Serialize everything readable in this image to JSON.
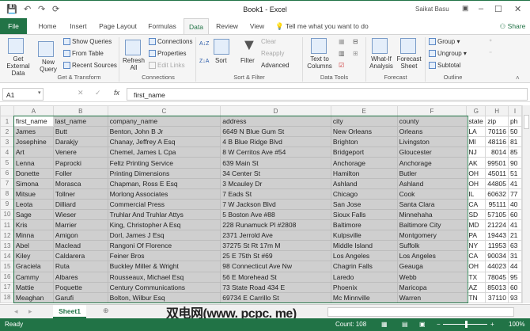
{
  "title": "Book1  -  Excel",
  "user": "Saikat Basu",
  "tabs": [
    "File",
    "Home",
    "Insert",
    "Page Layout",
    "Formulas",
    "Data",
    "Review",
    "View"
  ],
  "tell_me": "Tell me what you want to do",
  "share": "Share",
  "ribbon": {
    "get_external": "Get External Data",
    "new_query": "New Query",
    "show_queries": "Show Queries",
    "from_table": "From Table",
    "recent_sources": "Recent Sources",
    "get_transform": "Get & Transform",
    "refresh_all": "Refresh All",
    "connections": "Connections",
    "properties": "Properties",
    "edit_links": "Edit Links",
    "connections_group": "Connections",
    "sort": "Sort",
    "filter": "Filter",
    "clear": "Clear",
    "reapply": "Reapply",
    "advanced": "Advanced",
    "sort_filter": "Sort & Filter",
    "text_to_columns": "Text to Columns",
    "data_tools": "Data Tools",
    "what_if": "What-If Analysis",
    "forecast_sheet": "Forecast Sheet",
    "forecast": "Forecast",
    "group": "Group",
    "ungroup": "Ungroup",
    "subtotal": "Subtotal",
    "outline": "Outline"
  },
  "name_box": "A1",
  "formula": "first_name",
  "columns": [
    "A",
    "B",
    "C",
    "D",
    "E",
    "F",
    "G",
    "H",
    "I"
  ],
  "rows": [
    [
      "first_name",
      "last_name",
      "company_name",
      "address",
      "city",
      "county",
      "state",
      "zip",
      "ph"
    ],
    [
      "James",
      "Butt",
      "Benton, John B Jr",
      "6649 N Blue Gum St",
      "New Orleans",
      "Orleans",
      "LA",
      "70116",
      "50"
    ],
    [
      "Josephine",
      "Darakjy",
      "Chanay, Jeffrey A Esq",
      "4 B Blue Ridge Blvd",
      "Brighton",
      "Livingston",
      "MI",
      "48116",
      "81"
    ],
    [
      "Art",
      "Venere",
      "Chemel, James L Cpa",
      "8 W Cerritos Ave #54",
      "Bridgeport",
      "Gloucester",
      "NJ",
      "8014",
      "85"
    ],
    [
      "Lenna",
      "Paprocki",
      "Feltz Printing Service",
      "639 Main St",
      "Anchorage",
      "Anchorage",
      "AK",
      "99501",
      "90"
    ],
    [
      "Donette",
      "Foller",
      "Printing Dimensions",
      "34 Center St",
      "Hamilton",
      "Butler",
      "OH",
      "45011",
      "51"
    ],
    [
      "Simona",
      "Morasca",
      "Chapman, Ross E Esq",
      "3 Mcauley Dr",
      "Ashland",
      "Ashland",
      "OH",
      "44805",
      "41"
    ],
    [
      "Mitsue",
      "Tollner",
      "Morlong Associates",
      "7 Eads St",
      "Chicago",
      "Cook",
      "IL",
      "60632",
      "77"
    ],
    [
      "Leota",
      "Dilliard",
      "Commercial Press",
      "7 W Jackson Blvd",
      "San Jose",
      "Santa Clara",
      "CA",
      "95111",
      "40"
    ],
    [
      "Sage",
      "Wieser",
      "Truhlar And Truhlar Attys",
      "5 Boston Ave #88",
      "Sioux Falls",
      "Minnehaha",
      "SD",
      "57105",
      "60"
    ],
    [
      "Kris",
      "Marrier",
      "King, Christopher A Esq",
      "228 Runamuck Pl #2808",
      "Baltimore",
      "Baltimore City",
      "MD",
      "21224",
      "41"
    ],
    [
      "Minna",
      "Amigon",
      "Dorl, James J Esq",
      "2371 Jerrold Ave",
      "Kulpsville",
      "Montgomery",
      "PA",
      "19443",
      "21"
    ],
    [
      "Abel",
      "Maclead",
      "Rangoni Of Florence",
      "37275 St  Rt 17m M",
      "Middle Island",
      "Suffolk",
      "NY",
      "11953",
      "63"
    ],
    [
      "Kiley",
      "Caldarera",
      "Feiner Bros",
      "25 E 75th St #69",
      "Los Angeles",
      "Los Angeles",
      "CA",
      "90034",
      "31"
    ],
    [
      "Graciela",
      "Ruta",
      "Buckley Miller & Wright",
      "98 Connecticut Ave Nw",
      "Chagrin Falls",
      "Geauga",
      "OH",
      "44023",
      "44"
    ],
    [
      "Cammy",
      "Albares",
      "Rousseaux, Michael Esq",
      "56 E Morehead St",
      "Laredo",
      "Webb",
      "TX",
      "78045",
      "95"
    ],
    [
      "Mattie",
      "Poquette",
      "Century Communications",
      "73 State Road 434 E",
      "Phoenix",
      "Maricopa",
      "AZ",
      "85013",
      "60"
    ],
    [
      "Meaghan",
      "Garufi",
      "Bolton, Wilbur Esq",
      "69734 E Carrillo St",
      "Mc Minnville",
      "Warren",
      "TN",
      "37110",
      "93"
    ]
  ],
  "sheet_tab": "Sheet1",
  "watermark": "双电网(www. pcpc. me)",
  "status": {
    "ready": "Ready",
    "count": "Count: 108",
    "zoom": "100%"
  }
}
